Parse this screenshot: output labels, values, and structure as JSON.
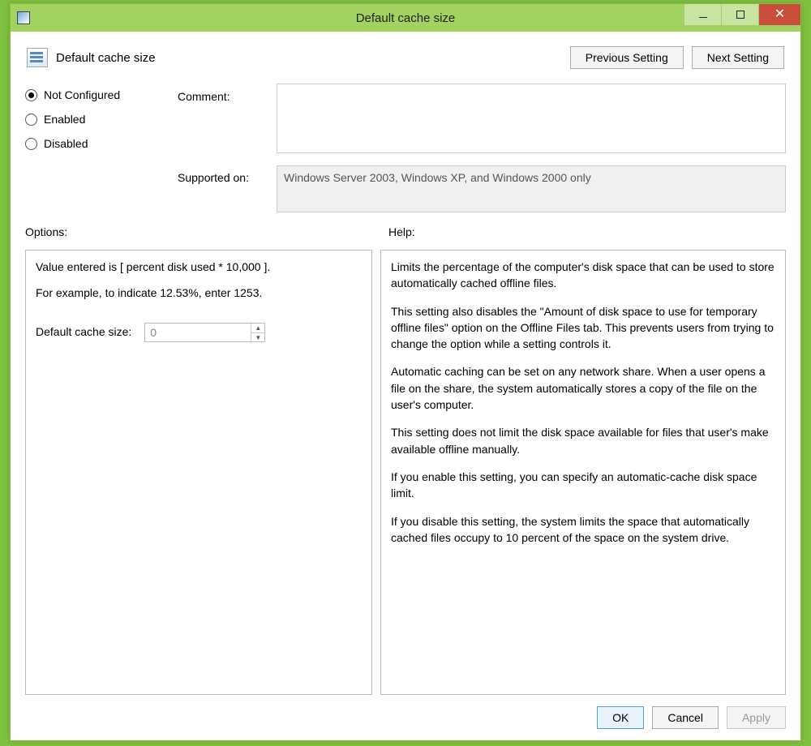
{
  "window": {
    "title": "Default cache size"
  },
  "header": {
    "title": "Default cache size",
    "prev": "Previous Setting",
    "next": "Next Setting"
  },
  "state": {
    "options": [
      {
        "label": "Not Configured",
        "selected": true
      },
      {
        "label": "Enabled",
        "selected": false
      },
      {
        "label": "Disabled",
        "selected": false
      }
    ],
    "comment_label": "Comment:",
    "comment_value": "",
    "supported_label": "Supported on:",
    "supported_value": "Windows Server 2003, Windows XP, and Windows 2000 only"
  },
  "sections": {
    "options_label": "Options:",
    "help_label": "Help:"
  },
  "options_pane": {
    "line1": "Value entered is [ percent disk used * 10,000 ].",
    "line2": "For example, to indicate 12.53%, enter 1253.",
    "spinner_label": "Default cache size:",
    "spinner_value": "0"
  },
  "help_pane": {
    "p1": "Limits the percentage of the computer's disk space that can be used to store automatically cached offline files.",
    "p2": "This setting also disables the \"Amount of disk space to use for temporary offline files\" option on the Offline Files tab. This prevents users from trying to change the option while a setting controls it.",
    "p3": "Automatic caching can be set on any network share. When a user opens a file on the share, the system automatically stores a copy of the file on the user's computer.",
    "p4": "This setting does not limit the disk space available for files that user's make available offline manually.",
    "p5": "If you enable this setting, you can specify an automatic-cache disk space limit.",
    "p6": "If you disable this setting, the system limits the space that automatically cached files occupy to 10 percent of the space on the system drive."
  },
  "footer": {
    "ok": "OK",
    "cancel": "Cancel",
    "apply": "Apply"
  }
}
